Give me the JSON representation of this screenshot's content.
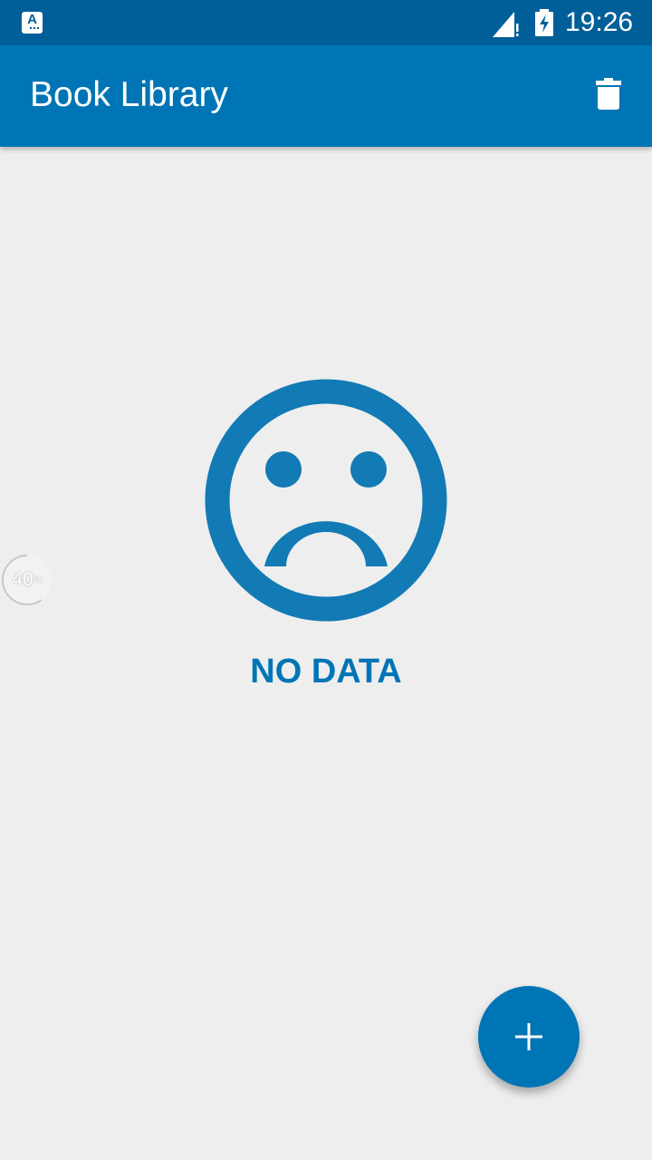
{
  "status_bar": {
    "time": "19:26",
    "app_icon_glyph": "A",
    "icons": [
      "app-notification-icon",
      "signal-icon",
      "battery-charging-icon"
    ]
  },
  "app_bar": {
    "title": "Book Library",
    "delete_icon": "trash-icon"
  },
  "empty_state": {
    "icon": "sad-face-icon",
    "message": "NO DATA"
  },
  "progress_overlay": {
    "value_text": "40",
    "unit": "%",
    "value": 0.4
  },
  "fab": {
    "icon": "plus-icon"
  },
  "colors": {
    "primary": "#0075b5",
    "primary_dark": "#005f99",
    "icon_blue": "#127ab4",
    "background": "#eeeeee"
  }
}
